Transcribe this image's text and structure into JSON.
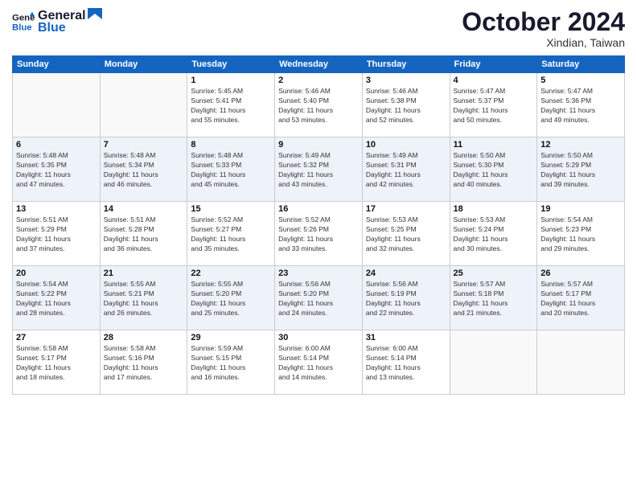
{
  "header": {
    "logo_line1": "General",
    "logo_line2": "Blue",
    "month": "October 2024",
    "location": "Xindian, Taiwan"
  },
  "weekdays": [
    "Sunday",
    "Monday",
    "Tuesday",
    "Wednesday",
    "Thursday",
    "Friday",
    "Saturday"
  ],
  "weeks": [
    [
      {
        "day": "",
        "info": ""
      },
      {
        "day": "",
        "info": ""
      },
      {
        "day": "1",
        "info": "Sunrise: 5:45 AM\nSunset: 5:41 PM\nDaylight: 11 hours\nand 55 minutes."
      },
      {
        "day": "2",
        "info": "Sunrise: 5:46 AM\nSunset: 5:40 PM\nDaylight: 11 hours\nand 53 minutes."
      },
      {
        "day": "3",
        "info": "Sunrise: 5:46 AM\nSunset: 5:38 PM\nDaylight: 11 hours\nand 52 minutes."
      },
      {
        "day": "4",
        "info": "Sunrise: 5:47 AM\nSunset: 5:37 PM\nDaylight: 11 hours\nand 50 minutes."
      },
      {
        "day": "5",
        "info": "Sunrise: 5:47 AM\nSunset: 5:36 PM\nDaylight: 11 hours\nand 49 minutes."
      }
    ],
    [
      {
        "day": "6",
        "info": "Sunrise: 5:48 AM\nSunset: 5:35 PM\nDaylight: 11 hours\nand 47 minutes."
      },
      {
        "day": "7",
        "info": "Sunrise: 5:48 AM\nSunset: 5:34 PM\nDaylight: 11 hours\nand 46 minutes."
      },
      {
        "day": "8",
        "info": "Sunrise: 5:48 AM\nSunset: 5:33 PM\nDaylight: 11 hours\nand 45 minutes."
      },
      {
        "day": "9",
        "info": "Sunrise: 5:49 AM\nSunset: 5:32 PM\nDaylight: 11 hours\nand 43 minutes."
      },
      {
        "day": "10",
        "info": "Sunrise: 5:49 AM\nSunset: 5:31 PM\nDaylight: 11 hours\nand 42 minutes."
      },
      {
        "day": "11",
        "info": "Sunrise: 5:50 AM\nSunset: 5:30 PM\nDaylight: 11 hours\nand 40 minutes."
      },
      {
        "day": "12",
        "info": "Sunrise: 5:50 AM\nSunset: 5:29 PM\nDaylight: 11 hours\nand 39 minutes."
      }
    ],
    [
      {
        "day": "13",
        "info": "Sunrise: 5:51 AM\nSunset: 5:29 PM\nDaylight: 11 hours\nand 37 minutes."
      },
      {
        "day": "14",
        "info": "Sunrise: 5:51 AM\nSunset: 5:28 PM\nDaylight: 11 hours\nand 36 minutes."
      },
      {
        "day": "15",
        "info": "Sunrise: 5:52 AM\nSunset: 5:27 PM\nDaylight: 11 hours\nand 35 minutes."
      },
      {
        "day": "16",
        "info": "Sunrise: 5:52 AM\nSunset: 5:26 PM\nDaylight: 11 hours\nand 33 minutes."
      },
      {
        "day": "17",
        "info": "Sunrise: 5:53 AM\nSunset: 5:25 PM\nDaylight: 11 hours\nand 32 minutes."
      },
      {
        "day": "18",
        "info": "Sunrise: 5:53 AM\nSunset: 5:24 PM\nDaylight: 11 hours\nand 30 minutes."
      },
      {
        "day": "19",
        "info": "Sunrise: 5:54 AM\nSunset: 5:23 PM\nDaylight: 11 hours\nand 29 minutes."
      }
    ],
    [
      {
        "day": "20",
        "info": "Sunrise: 5:54 AM\nSunset: 5:22 PM\nDaylight: 11 hours\nand 28 minutes."
      },
      {
        "day": "21",
        "info": "Sunrise: 5:55 AM\nSunset: 5:21 PM\nDaylight: 11 hours\nand 26 minutes."
      },
      {
        "day": "22",
        "info": "Sunrise: 5:55 AM\nSunset: 5:20 PM\nDaylight: 11 hours\nand 25 minutes."
      },
      {
        "day": "23",
        "info": "Sunrise: 5:56 AM\nSunset: 5:20 PM\nDaylight: 11 hours\nand 24 minutes."
      },
      {
        "day": "24",
        "info": "Sunrise: 5:56 AM\nSunset: 5:19 PM\nDaylight: 11 hours\nand 22 minutes."
      },
      {
        "day": "25",
        "info": "Sunrise: 5:57 AM\nSunset: 5:18 PM\nDaylight: 11 hours\nand 21 minutes."
      },
      {
        "day": "26",
        "info": "Sunrise: 5:57 AM\nSunset: 5:17 PM\nDaylight: 11 hours\nand 20 minutes."
      }
    ],
    [
      {
        "day": "27",
        "info": "Sunrise: 5:58 AM\nSunset: 5:17 PM\nDaylight: 11 hours\nand 18 minutes."
      },
      {
        "day": "28",
        "info": "Sunrise: 5:58 AM\nSunset: 5:16 PM\nDaylight: 11 hours\nand 17 minutes."
      },
      {
        "day": "29",
        "info": "Sunrise: 5:59 AM\nSunset: 5:15 PM\nDaylight: 11 hours\nand 16 minutes."
      },
      {
        "day": "30",
        "info": "Sunrise: 6:00 AM\nSunset: 5:14 PM\nDaylight: 11 hours\nand 14 minutes."
      },
      {
        "day": "31",
        "info": "Sunrise: 6:00 AM\nSunset: 5:14 PM\nDaylight: 11 hours\nand 13 minutes."
      },
      {
        "day": "",
        "info": ""
      },
      {
        "day": "",
        "info": ""
      }
    ]
  ]
}
